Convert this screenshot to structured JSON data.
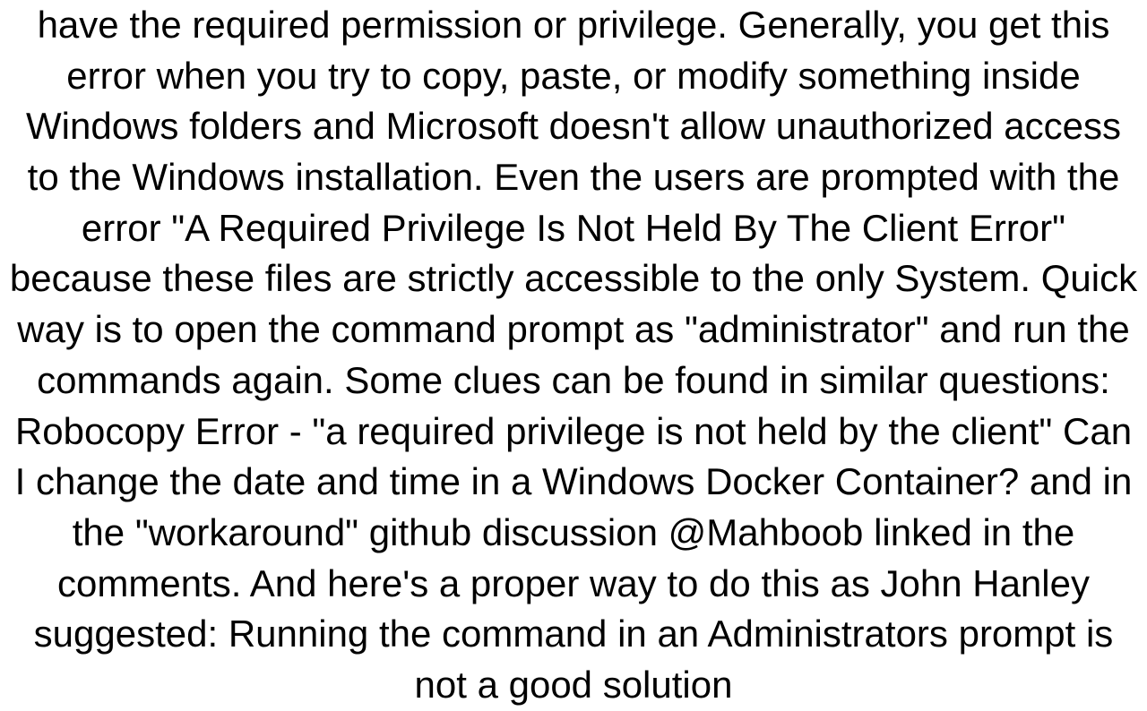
{
  "content": {
    "paragraph": "have the required permission or privilege. Generally, you get this error when you try to copy, paste, or modify something inside Windows folders and Microsoft doesn't allow unauthorized access to the Windows installation. Even the users are prompted with the error \"A Required Privilege Is Not Held By The Client Error\" because these files are strictly accessible to the only System.  Quick way is to open the command prompt as \"administrator\" and run the commands again. Some clues can be found in similar questions:  Robocopy Error - \"a required privilege is not held by the client\" Can I change the date and time in a Windows Docker Container?  and in the \"workaround\" github discussion @Mahboob linked in the comments. And here's a proper way to do this as John Hanley suggested:  Running the command in an Administrators prompt is not a good solution"
  }
}
